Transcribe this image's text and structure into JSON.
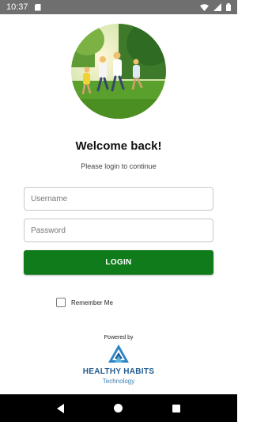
{
  "status_bar": {
    "time": "10:37"
  },
  "login": {
    "title": "Welcome back!",
    "subtitle": "Please login to continue",
    "username_placeholder": "Username",
    "username_value": "",
    "password_placeholder": "Password",
    "password_value": "",
    "login_button": "LOGIN",
    "remember_me": "Remember Me",
    "remember_checked": false
  },
  "footer": {
    "powered_by": "Powered by",
    "brand_name": "HEALTHY HABITS",
    "brand_sub": "Technology"
  },
  "colors": {
    "accent": "#107b1a",
    "brand": "#1d5a8e"
  }
}
